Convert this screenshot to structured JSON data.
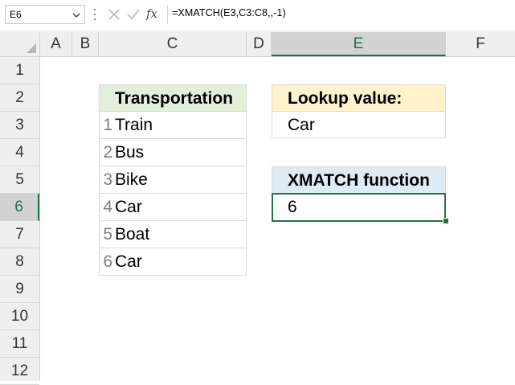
{
  "formula_bar": {
    "name_box": "E6",
    "fx_label": "fx",
    "formula": "=XMATCH(E3,C3:C8,,-1)"
  },
  "columns": [
    "A",
    "B",
    "C",
    "D",
    "E",
    "F"
  ],
  "rows": [
    "1",
    "2",
    "3",
    "4",
    "5",
    "6",
    "7",
    "8",
    "9",
    "10",
    "11",
    "12"
  ],
  "selected": {
    "column": "E",
    "row": "6"
  },
  "table": {
    "header": "Transportation",
    "indices": [
      "1",
      "2",
      "3",
      "4",
      "5",
      "6"
    ],
    "items": [
      "Train",
      "Bus",
      "Bike",
      "Car",
      "Boat",
      "Car"
    ]
  },
  "lookup": {
    "header": "Lookup value:",
    "value": "Car"
  },
  "result": {
    "header": "XMATCH function",
    "value": "6"
  },
  "colors": {
    "accent": "#217346",
    "table_header": "#e2efda",
    "lookup_header": "#fff2cc",
    "xmatch_header": "#ddebf7"
  }
}
